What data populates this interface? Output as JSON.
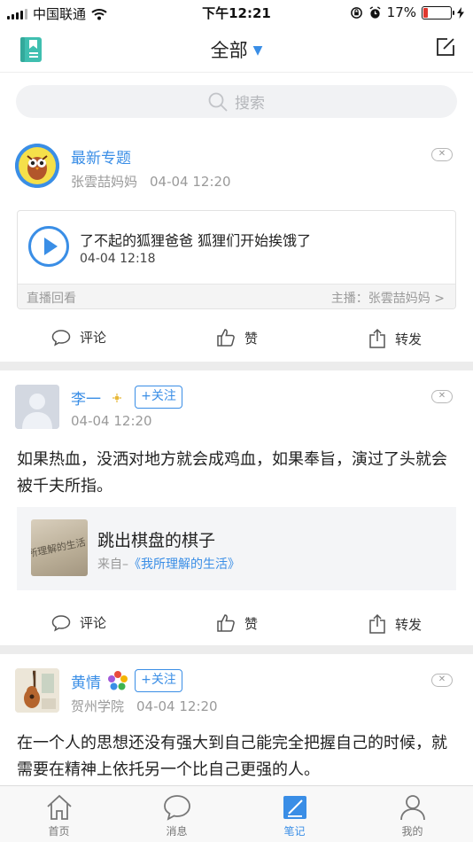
{
  "status_bar": {
    "carrier": "中国联通",
    "time": "下午12:21",
    "battery": "17%",
    "battery_level": 0.17
  },
  "nav": {
    "title": "全部"
  },
  "search": {
    "placeholder": "搜索"
  },
  "posts": [
    {
      "type": "live",
      "author": "最新专题",
      "source": "张雲喆妈妈",
      "time": "04-04 12:20",
      "live": {
        "title": "了不起的狐狸爸爸 狐狸们开始挨饿了",
        "time": "04-04 12:18",
        "replay_label": "直播回看",
        "host": "主播：张雲喆妈妈 >"
      }
    },
    {
      "type": "note",
      "author": "李一",
      "follow_label": "+关注",
      "time": "04-04 12:20",
      "text": "如果热血，没洒对地方就会成鸡血，如果奉旨，演过了头就会被千夫所指。",
      "quote": {
        "thumb_text": "所理解的生活",
        "title": "跳出棋盘的棋子",
        "from_prefix": "来自–",
        "from": "《我所理解的生活》"
      }
    },
    {
      "type": "note",
      "author": "黄情",
      "follow_label": "+关注",
      "school": "贺州学院",
      "time": "04-04 12:20",
      "text": "在一个人的思想还没有强大到自己能完全把握自己的时候，就需要在精神上依托另一个比自己更强的人。"
    }
  ],
  "actions": {
    "comment": "评论",
    "like": "赞",
    "share": "转发"
  },
  "tabs": [
    {
      "label": "首页",
      "icon": "home-icon"
    },
    {
      "label": "消息",
      "icon": "message-icon"
    },
    {
      "label": "笔记",
      "icon": "note-icon",
      "active": true
    },
    {
      "label": "我的",
      "icon": "profile-icon"
    }
  ],
  "colors": {
    "accent": "#3a8ee6",
    "battery_low": "#e0382f",
    "divider": "#ececec",
    "note_icon": "#3fbfb0"
  }
}
